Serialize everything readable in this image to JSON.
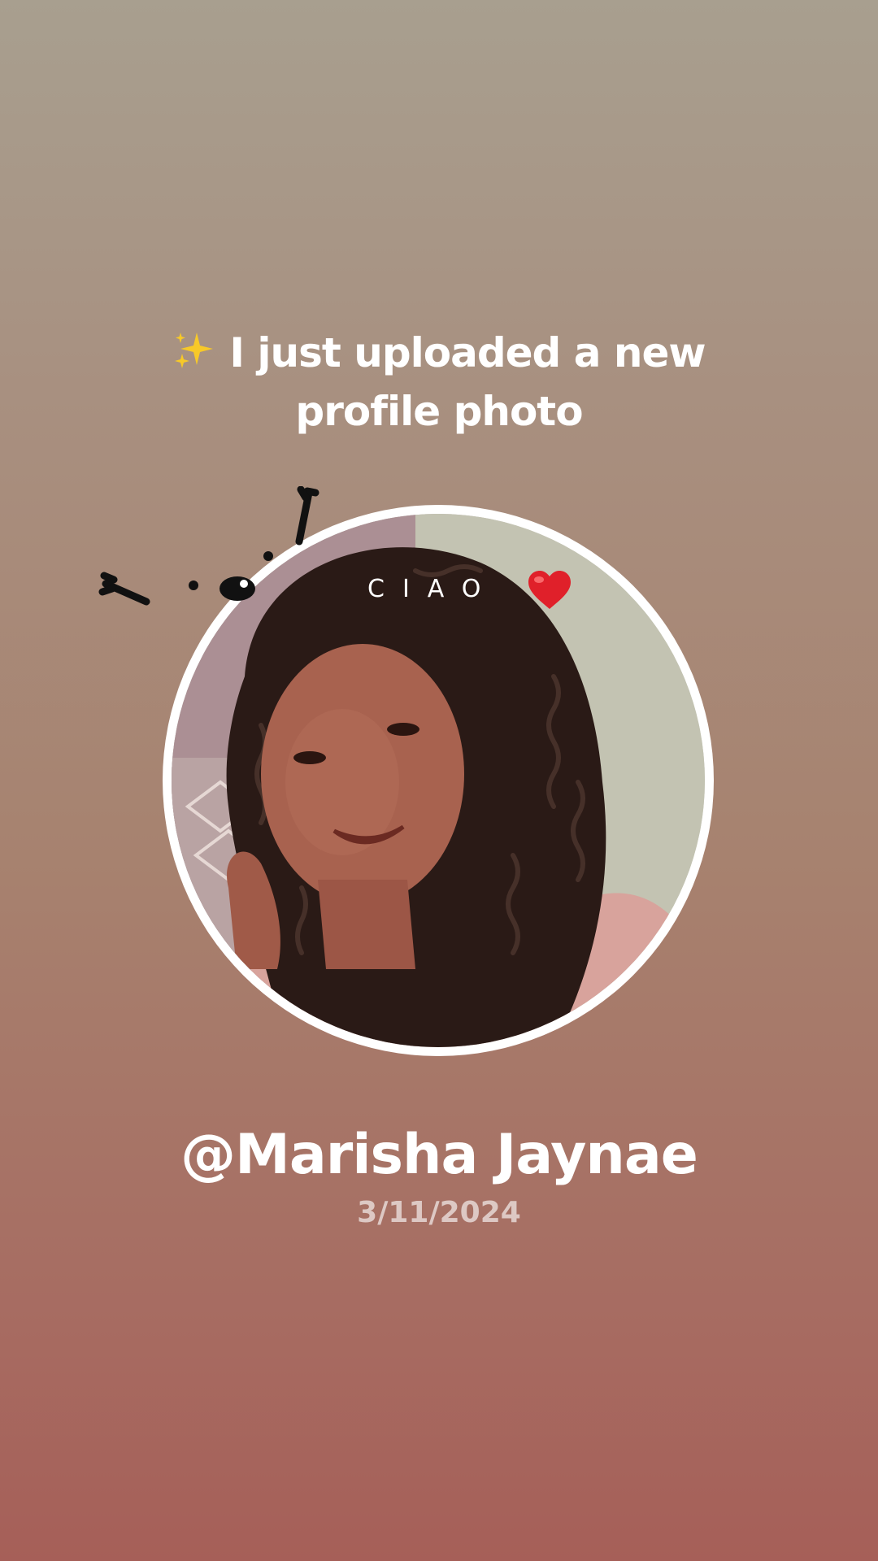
{
  "headline": {
    "icon": "sparkles-icon",
    "line1": "I just uploaded a new",
    "line2": "profile photo"
  },
  "avatar": {
    "overlay_text": "CIAO",
    "overlay_icon": "red-heart-icon",
    "doodle_icon": "critter-doodle-icon",
    "ring_color": "#ffffff"
  },
  "profile": {
    "username": "@Marisha Jaynae",
    "date": "3/11/2024"
  },
  "colors": {
    "background_top": "#a89f8f",
    "background_bottom": "#a65f58",
    "text": "#ffffff",
    "heart": "#e0202a",
    "sparkle": "#f5c518"
  }
}
